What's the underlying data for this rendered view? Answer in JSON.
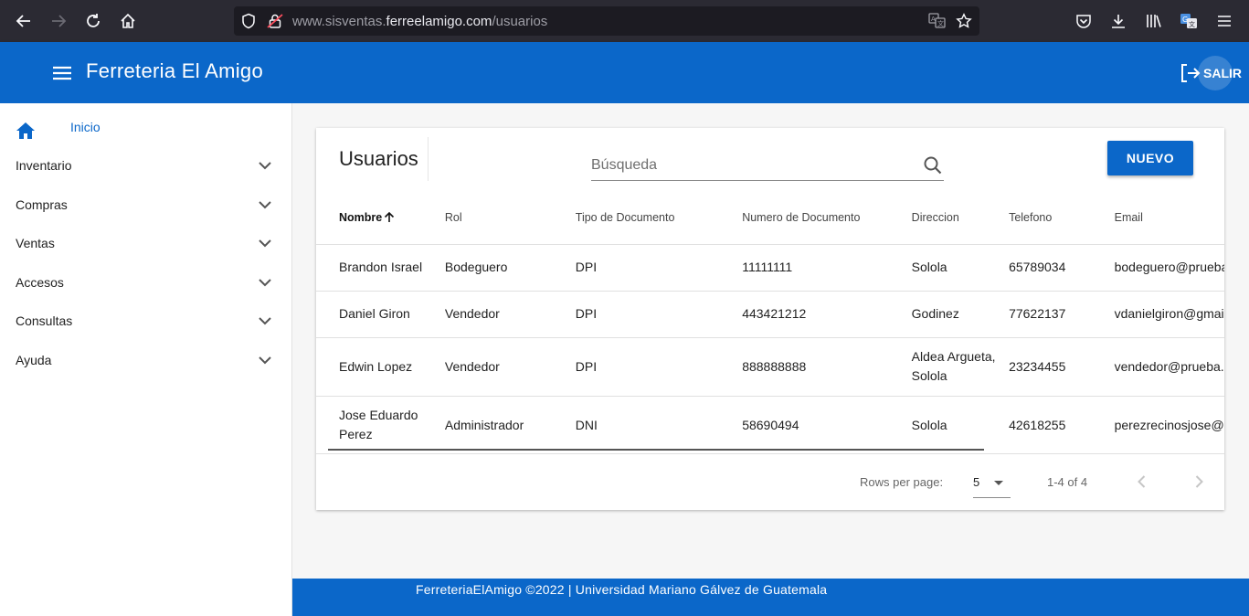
{
  "browser": {
    "url_prefix": "www.sisventas.",
    "url_host": "ferreelamigo.com",
    "url_path": "/usuarios"
  },
  "appbar": {
    "title": "Ferreteria El Amigo",
    "logout_label": "SALIR"
  },
  "sidebar": {
    "items": [
      {
        "label": "Inicio"
      },
      {
        "label": "Inventario"
      },
      {
        "label": "Compras"
      },
      {
        "label": "Ventas"
      },
      {
        "label": "Accesos"
      },
      {
        "label": "Consultas"
      },
      {
        "label": "Ayuda"
      }
    ]
  },
  "main": {
    "title": "Usuarios",
    "search_placeholder": "Búsqueda",
    "new_button": "NUEVO",
    "columns": [
      "Nombre",
      "Rol",
      "Tipo de Documento",
      "Numero de Documento",
      "Direccion",
      "Telefono",
      "Email"
    ],
    "rows": [
      [
        "Brandon Israel",
        "Bodeguero",
        "DPI",
        "11111111",
        "Solola",
        "65789034",
        "bodeguero@prueba.com"
      ],
      [
        "Daniel Giron",
        "Vendedor",
        "DPI",
        "443421212",
        "Godinez",
        "77622137",
        "vdanielgiron@gmail.com"
      ],
      [
        "Edwin Lopez",
        "Vendedor",
        "DPI",
        "888888888",
        "Aldea Argueta, Solola",
        "23234455",
        "vendedor@prueba.com"
      ],
      [
        "Jose Eduardo Perez",
        "Administrador",
        "DNI",
        "58690494",
        "Solola",
        "42618255",
        "perezrecinosjose@gmail.com"
      ]
    ],
    "pagination": {
      "rows_per_page_label": "Rows per page:",
      "rows_per_page_value": "5",
      "range": "1-4 of 4"
    }
  },
  "footer": {
    "text": "FerreteriaElAmigo ©2022 | Universidad Mariano Gálvez de Guatemala"
  },
  "colors": {
    "primary": "#0b67c9",
    "browser_chrome": "#2b2a33"
  }
}
